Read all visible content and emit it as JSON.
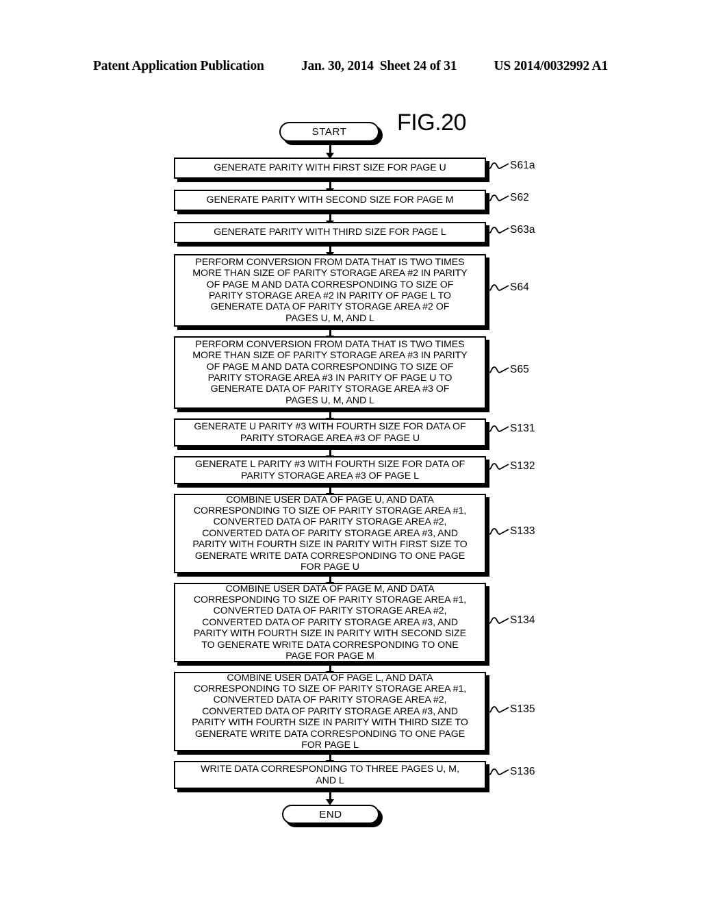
{
  "header": {
    "left": "Patent Application Publication",
    "date": "Jan. 30, 2014",
    "sheet": "Sheet 24 of 31",
    "right": "US 2014/0032992 A1"
  },
  "figure": {
    "title": "FIG.20",
    "start_label": "START",
    "end_label": "END"
  },
  "colors": {
    "ink": "#000000",
    "paper": "#ffffff"
  },
  "steps": [
    {
      "id": "S61a",
      "text": "GENERATE PARITY WITH FIRST SIZE FOR PAGE U"
    },
    {
      "id": "S62",
      "text": "GENERATE PARITY WITH SECOND SIZE FOR PAGE M"
    },
    {
      "id": "S63a",
      "text": "GENERATE PARITY WITH THIRD SIZE FOR PAGE L"
    },
    {
      "id": "S64",
      "text": "PERFORM CONVERSION FROM DATA THAT IS TWO TIMES\nMORE THAN SIZE OF PARITY STORAGE AREA #2 IN PARITY\nOF PAGE M AND DATA CORRESPONDING TO SIZE OF\nPARITY STORAGE AREA #2 IN PARITY OF PAGE L TO\nGENERATE DATA OF PARITY STORAGE AREA #2 OF\nPAGES U, M, AND L"
    },
    {
      "id": "S65",
      "text": "PERFORM CONVERSION FROM DATA THAT IS TWO TIMES\nMORE THAN SIZE OF PARITY STORAGE AREA #3 IN PARITY\nOF PAGE M AND DATA CORRESPONDING TO SIZE OF\nPARITY STORAGE AREA #3 IN PARITY OF PAGE U TO\nGENERATE DATA OF PARITY STORAGE AREA #3 OF\nPAGES U, M, AND L"
    },
    {
      "id": "S131",
      "text": "GENERATE U PARITY #3 WITH FOURTH SIZE FOR DATA OF\nPARITY STORAGE AREA #3 OF PAGE U"
    },
    {
      "id": "S132",
      "text": "GENERATE L PARITY #3 WITH FOURTH SIZE FOR DATA OF\nPARITY STORAGE AREA #3 OF PAGE L"
    },
    {
      "id": "S133",
      "text": "COMBINE USER DATA OF PAGE U, AND DATA\nCORRESPONDING TO SIZE OF PARITY STORAGE AREA #1,\nCONVERTED DATA OF PARITY STORAGE AREA #2,\nCONVERTED DATA OF PARITY STORAGE AREA #3, AND\nPARITY WITH FOURTH SIZE IN PARITY WITH FIRST SIZE TO\nGENERATE WRITE DATA CORRESPONDING TO ONE PAGE\nFOR PAGE U"
    },
    {
      "id": "S134",
      "text": "COMBINE USER DATA OF PAGE M, AND DATA\nCORRESPONDING TO SIZE OF PARITY STORAGE AREA #1,\nCONVERTED DATA OF PARITY STORAGE AREA #2,\nCONVERTED DATA OF PARITY STORAGE AREA #3, AND\nPARITY WITH FOURTH SIZE IN PARITY WITH SECOND SIZE\nTO GENERATE WRITE DATA CORRESPONDING TO ONE\nPAGE FOR PAGE M"
    },
    {
      "id": "S135",
      "text": "COMBINE USER DATA OF PAGE L, AND DATA\nCORRESPONDING TO SIZE OF PARITY STORAGE AREA #1,\nCONVERTED DATA OF PARITY STORAGE AREA #2,\nCONVERTED DATA OF PARITY STORAGE AREA #3, AND\nPARITY WITH FOURTH SIZE IN PARITY WITH THIRD SIZE TO\nGENERATE WRITE DATA CORRESPONDING TO ONE PAGE\nFOR PAGE L"
    },
    {
      "id": "S136",
      "text": "WRITE DATA CORRESPONDING TO THREE PAGES U, M,\nAND L"
    }
  ]
}
